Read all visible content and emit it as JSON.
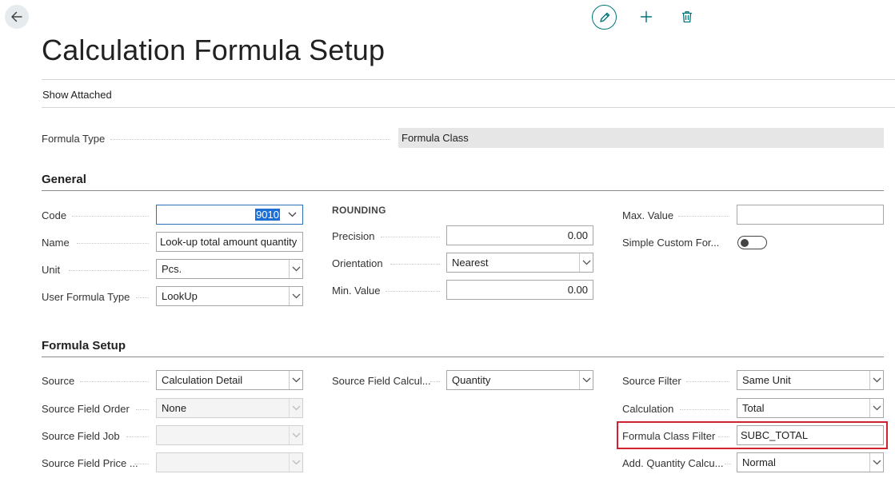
{
  "page": {
    "title": "Calculation Formula Setup",
    "show_attached": "Show Attached"
  },
  "icons": {
    "back": "arrow-left-icon",
    "edit": "pencil-icon",
    "add": "plus-icon",
    "delete": "trash-icon"
  },
  "colors": {
    "accent": "#00757a",
    "highlight": "#d2222d",
    "selection": "#1d6fd6"
  },
  "header_fields": {
    "formula_type": {
      "label": "Formula Type",
      "value": "Formula Class"
    }
  },
  "general": {
    "title": "General",
    "code": {
      "label": "Code",
      "value": "9010"
    },
    "name": {
      "label": "Name",
      "value": "Look-up total amount quantity"
    },
    "unit": {
      "label": "Unit",
      "value": "Pcs."
    },
    "user_formula_type": {
      "label": "User Formula Type",
      "value": "LookUp"
    },
    "rounding": {
      "heading": "ROUNDING",
      "precision": {
        "label": "Precision",
        "value": "0.00"
      },
      "orientation": {
        "label": "Orientation",
        "value": "Nearest"
      },
      "min_value": {
        "label": "Min. Value",
        "value": "0.00"
      }
    },
    "max_value": {
      "label": "Max. Value",
      "value": ""
    },
    "simple_custom_formula": {
      "label": "Simple Custom For...",
      "value": false
    }
  },
  "formula_setup": {
    "title": "Formula Setup",
    "source": {
      "label": "Source",
      "value": "Calculation Detail"
    },
    "source_field_order": {
      "label": "Source Field Order",
      "value": "None"
    },
    "source_field_job": {
      "label": "Source Field Job",
      "value": ""
    },
    "source_field_price": {
      "label": "Source Field Price ...",
      "value": ""
    },
    "source_field_calculation": {
      "label": "Source Field Calcul...",
      "value": "Quantity"
    },
    "source_filter": {
      "label": "Source Filter",
      "value": "Same Unit"
    },
    "calculation": {
      "label": "Calculation",
      "value": "Total"
    },
    "formula_class_filter": {
      "label": "Formula Class Filter",
      "value": "SUBC_TOTAL"
    },
    "add_quantity_calculation": {
      "label": "Add. Quantity Calcu...",
      "value": "Normal"
    }
  }
}
